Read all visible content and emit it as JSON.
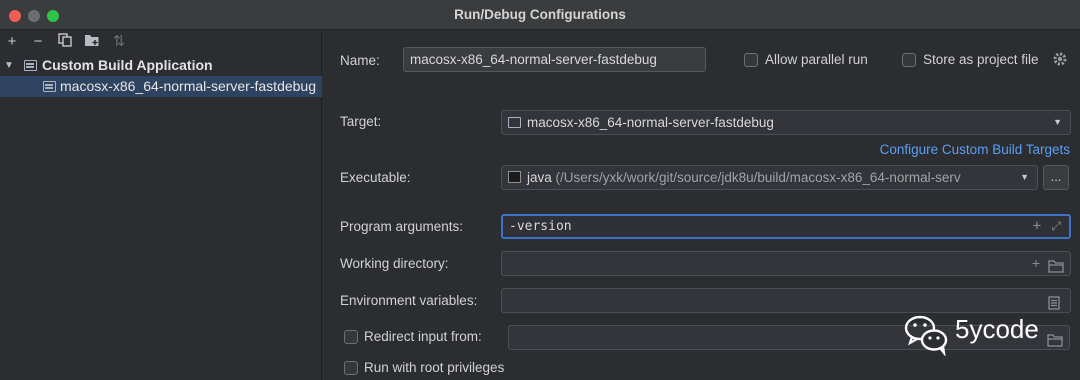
{
  "window": {
    "title": "Run/Debug Configurations"
  },
  "toolbar": {
    "add": "+",
    "remove": "−",
    "copy": "⧉",
    "folder": "▣",
    "sort": "⇅"
  },
  "tree": {
    "parent_label": "Custom Build Application",
    "child_label": "macosx-x86_64-normal-server-fastdebug"
  },
  "form": {
    "name_label": "Name:",
    "name_value": "macosx-x86_64-normal-server-fastdebug",
    "allow_parallel_label": "Allow parallel run",
    "store_project_label": "Store as project file",
    "target_label": "Target:",
    "target_value": "macosx-x86_64-normal-server-fastdebug",
    "configure_link": "Configure Custom Build Targets",
    "executable_label": "Executable:",
    "executable_name": "java",
    "executable_path": "(/Users/yxk/work/git/source/jdk8u/build/macosx-x86_64-normal-serv",
    "browse_label": "...",
    "program_args_label": "Program arguments:",
    "program_args_value": "-version",
    "working_dir_label": "Working directory:",
    "working_dir_value": "",
    "env_vars_label": "Environment variables:",
    "env_vars_value": "",
    "redirect_label": "Redirect input from:",
    "root_privileges_label": "Run with root privileges"
  },
  "watermark": {
    "text": "5ycode"
  },
  "icons": {
    "close": "close-icon",
    "minimize": "minimize-icon",
    "zoom": "zoom-icon",
    "settings": "gear-icon",
    "expand": "expand-icon",
    "folder": "folder-icon",
    "document": "document-icon"
  },
  "colors": {
    "accent": "#3b73c8",
    "link": "#5a9ef5",
    "selection": "#2e4360",
    "background": "#2b2d30"
  }
}
